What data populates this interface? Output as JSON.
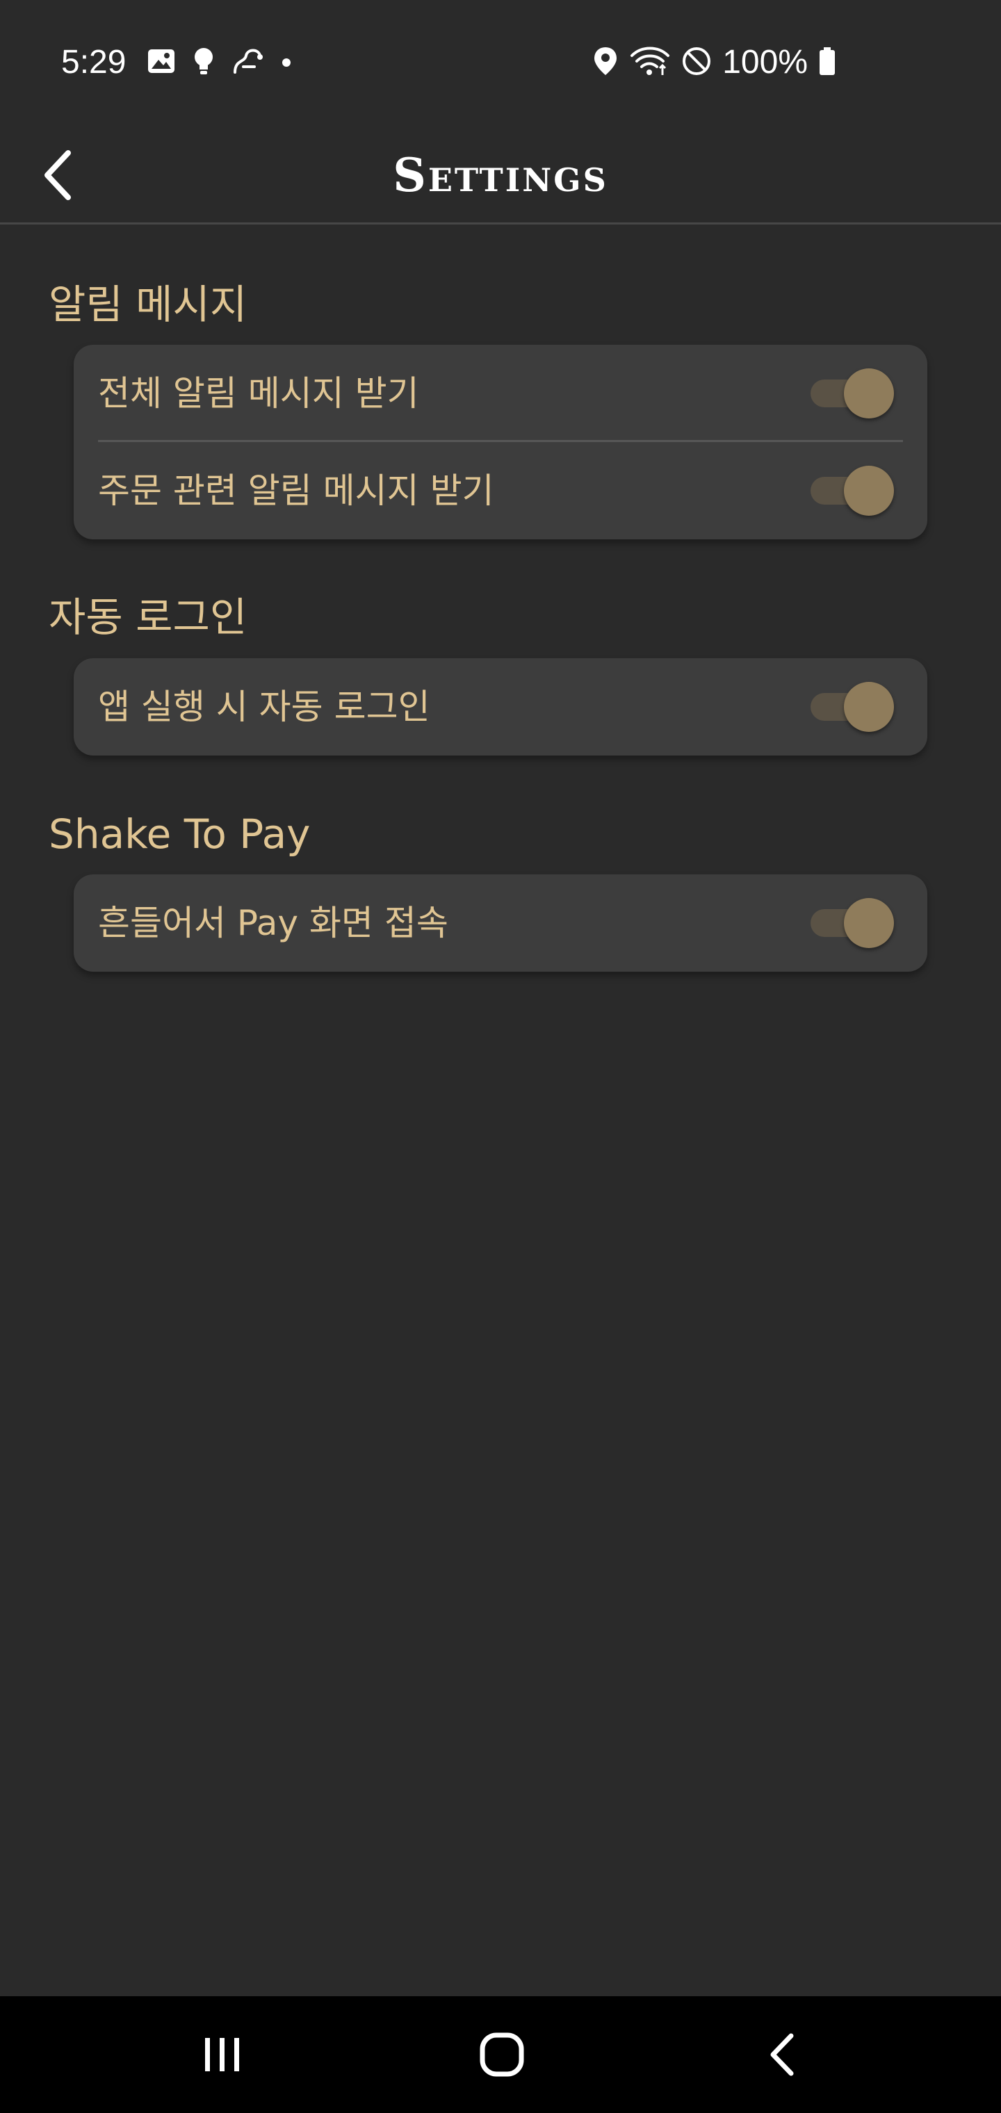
{
  "status_bar": {
    "time": "5:29",
    "battery": "100%",
    "left_icons": [
      "gallery-icon",
      "bulb-icon",
      "link-icon",
      "dot-icon"
    ],
    "right_icons": [
      "location-icon",
      "wifi-icon",
      "do-not-disturb-icon",
      "battery-icon"
    ]
  },
  "app_bar": {
    "title": "Settings",
    "back_icon": "chevron-left-icon"
  },
  "sections": [
    {
      "title": "알림 메시지",
      "items": [
        {
          "label": "전체 알림 메시지 받기",
          "enabled": true
        },
        {
          "label": "주문 관련 알림 메시지 받기",
          "enabled": true
        }
      ]
    },
    {
      "title": "자동 로그인",
      "items": [
        {
          "label": "앱 실행 시 자동 로그인",
          "enabled": true
        }
      ]
    },
    {
      "title": "Shake To Pay",
      "items": [
        {
          "label": "흔들어서 Pay 화면 접속",
          "enabled": true
        }
      ]
    }
  ],
  "nav_bar": {
    "recents_icon": "recents-icon",
    "home_icon": "home-icon",
    "back_icon": "back-icon"
  },
  "colors": {
    "background": "#2a2a2a",
    "card": "#3d3d3d",
    "accent_text": "#e0c593",
    "toggle_knob": "#8f7c5b",
    "toggle_track": "#5a5245"
  }
}
